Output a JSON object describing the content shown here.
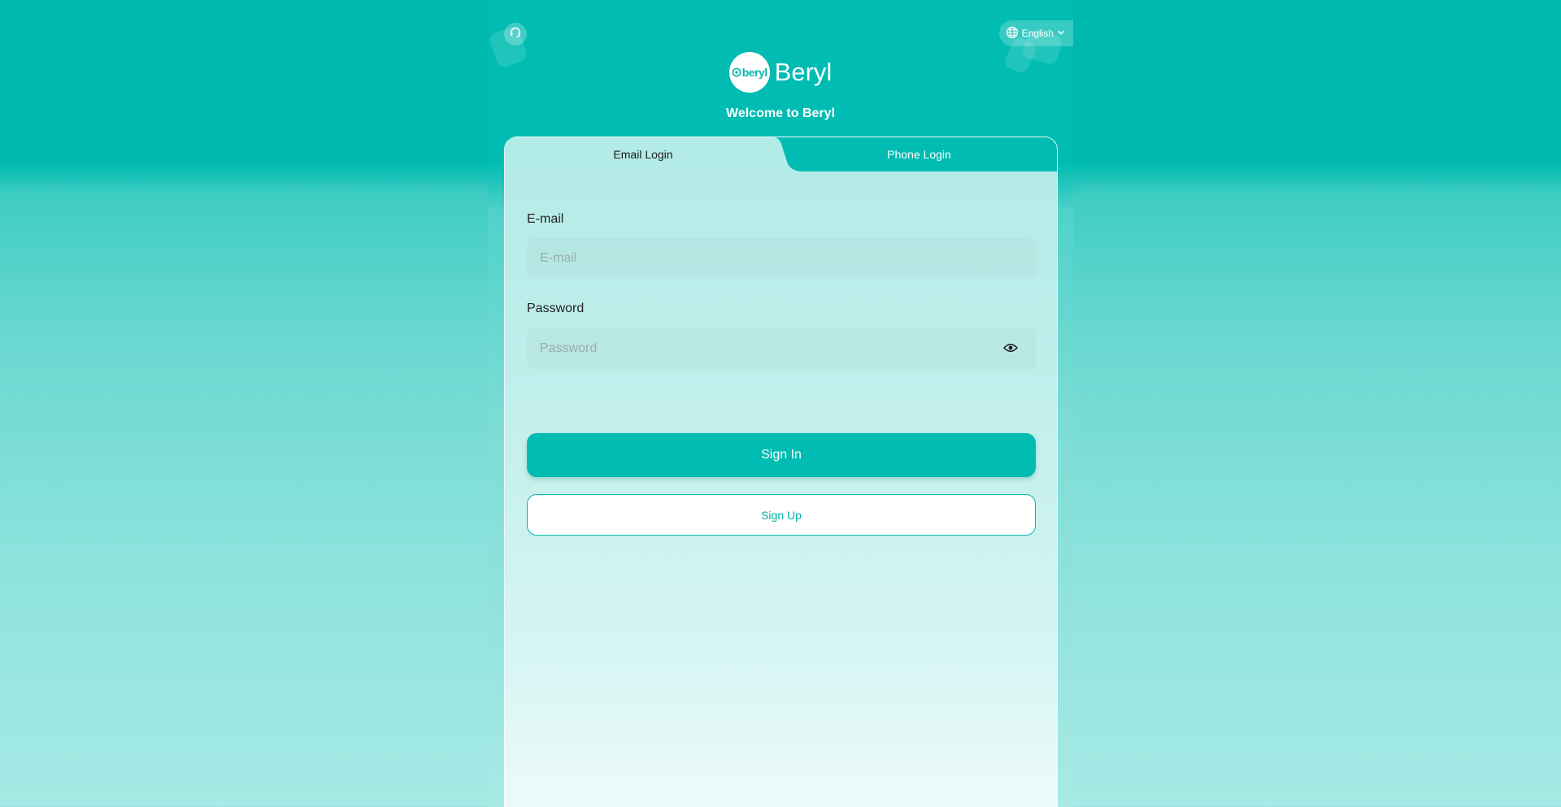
{
  "header": {
    "support_icon": "headset-icon",
    "language": {
      "label": "English",
      "icon": "globe-icon",
      "chevron": "chevron-down-icon"
    },
    "logo_text": "beryl",
    "brand_name": "Beryl",
    "welcome": "Welcome to Beryl"
  },
  "tabs": [
    {
      "label": "Email Login",
      "active": true
    },
    {
      "label": "Phone Login",
      "active": false
    }
  ],
  "form": {
    "email_label": "E-mail",
    "email_placeholder": "E-mail",
    "email_value": "",
    "password_label": "Password",
    "password_placeholder": "Password",
    "password_value": "",
    "password_toggle_icon": "eye-icon",
    "signin_label": "Sign In",
    "signup_label": "Sign Up"
  },
  "colors": {
    "accent": "#00b9ae",
    "accent_text": "#00b0a6",
    "card_bg": "#c2efec"
  }
}
